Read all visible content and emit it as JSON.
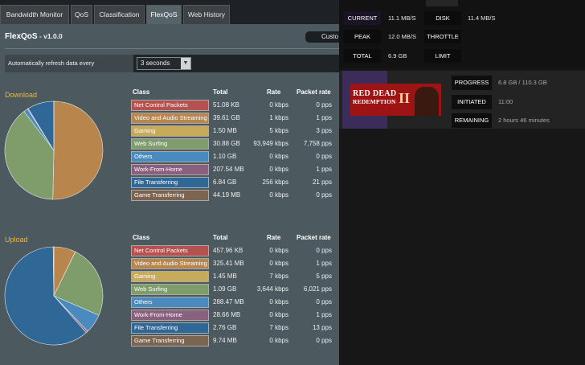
{
  "tabs": [
    {
      "label": "Bandwidth Monitor"
    },
    {
      "label": "QoS"
    },
    {
      "label": "Classification"
    },
    {
      "label": "FlexQoS"
    },
    {
      "label": "Web History"
    }
  ],
  "header": {
    "app_name": "FlexQoS",
    "version": " - v1.0.0",
    "custom_button": "Custo"
  },
  "refresh": {
    "label": "Automatically refresh data every",
    "value": "3 seconds"
  },
  "table_headers": {
    "class": "Class",
    "total": "Total",
    "rate": "Rate",
    "packet_rate": "Packet rate"
  },
  "download": {
    "label": "Download",
    "rows": [
      {
        "class": "Net Control Packets",
        "total": "51.08 KB",
        "rate": "0 kbps",
        "packet_rate": "0 pps",
        "color": "#b5514f"
      },
      {
        "class": "Video and Audio Streaming",
        "total": "39.61 GB",
        "rate": "1 kbps",
        "packet_rate": "1 pps",
        "color": "#b8864d"
      },
      {
        "class": "Gaming",
        "total": "1.50 MB",
        "rate": "5 kbps",
        "packet_rate": "3 pps",
        "color": "#c8aa5b"
      },
      {
        "class": "Web Surfing",
        "total": "30.88 GB",
        "rate": "93,949 kbps",
        "packet_rate": "7,758 pps",
        "color": "#7f9d6b"
      },
      {
        "class": "Others",
        "total": "1.10 GB",
        "rate": "0 kbps",
        "packet_rate": "0 pps",
        "color": "#4a8bbf"
      },
      {
        "class": "Work-From-Home",
        "total": "207.54 MB",
        "rate": "0 kbps",
        "packet_rate": "1 pps",
        "color": "#8a607f"
      },
      {
        "class": "File Transferring",
        "total": "6.84 GB",
        "rate": "256 kbps",
        "packet_rate": "21 pps",
        "color": "#2f6896"
      },
      {
        "class": "Game Transferring",
        "total": "44.19 MB",
        "rate": "0 kbps",
        "packet_rate": "0 pps",
        "color": "#7b6550"
      }
    ]
  },
  "upload": {
    "label": "Upload",
    "rows": [
      {
        "class": "Net Control Packets",
        "total": "457.96 KB",
        "rate": "0 kbps",
        "packet_rate": "0 pps",
        "color": "#b5514f"
      },
      {
        "class": "Video and Audio Streaming",
        "total": "325.41 MB",
        "rate": "0 kbps",
        "packet_rate": "1 pps",
        "color": "#b8864d"
      },
      {
        "class": "Gaming",
        "total": "1.45 MB",
        "rate": "7 kbps",
        "packet_rate": "5 pps",
        "color": "#c8aa5b"
      },
      {
        "class": "Web Surfing",
        "total": "1.09 GB",
        "rate": "3,644 kbps",
        "packet_rate": "6,021 pps",
        "color": "#7f9d6b"
      },
      {
        "class": "Others",
        "total": "288.47 MB",
        "rate": "0 kbps",
        "packet_rate": "0 pps",
        "color": "#4a8bbf"
      },
      {
        "class": "Work-From-Home",
        "total": "28.66 MB",
        "rate": "0 kbps",
        "packet_rate": "1 pps",
        "color": "#8a607f"
      },
      {
        "class": "File Transferring",
        "total": "2.76 GB",
        "rate": "7 kbps",
        "packet_rate": "13 pps",
        "color": "#2f6896"
      },
      {
        "class": "Game Transferring",
        "total": "9.74 MB",
        "rate": "0 kbps",
        "packet_rate": "0 pps",
        "color": "#7b6550"
      }
    ]
  },
  "chart_data": [
    {
      "type": "pie",
      "title": "Download",
      "categories": [
        "Net Control Packets",
        "Video and Audio Streaming",
        "Gaming",
        "Web Surfing",
        "Others",
        "Work-From-Home",
        "File Transferring",
        "Game Transferring"
      ],
      "values": [
        5e-05,
        39.61,
        0.0015,
        30.88,
        1.1,
        0.2075,
        6.84,
        0.0442
      ],
      "unit": "GB"
    },
    {
      "type": "pie",
      "title": "Upload",
      "categories": [
        "Net Control Packets",
        "Video and Audio Streaming",
        "Gaming",
        "Web Surfing",
        "Others",
        "Work-From-Home",
        "File Transferring",
        "Game Transferring"
      ],
      "values": [
        0.00046,
        0.3254,
        0.00145,
        1.09,
        0.2885,
        0.0287,
        2.76,
        0.0097
      ],
      "unit": "GB"
    }
  ],
  "overlay": {
    "stats": {
      "current_label": "CURRENT",
      "current_value": "11.1 MB/S",
      "disk_label": "DISK",
      "disk_value": "11.4 MB/S",
      "peak_label": "PEAK",
      "peak_value": "12.0 MB/S",
      "throttle_label": "THROTTLE",
      "total_label": "TOTAL",
      "total_value": "6.9 GB",
      "limit_label": "LIMIT"
    },
    "download": {
      "game_logo_line1": "RED DEAD",
      "game_logo_line2": "REDEMPTION",
      "game_logo_numeral": "II",
      "progress_label": "PROGRESS",
      "progress_value": "6.8 GB / 110.3 GB",
      "initiated_label": "INITIATED",
      "initiated_value": "11:00",
      "remaining_label": "REMAINING",
      "remaining_value": "2 hours 46 minutes"
    },
    "accent_color": "#3b2c5a"
  }
}
